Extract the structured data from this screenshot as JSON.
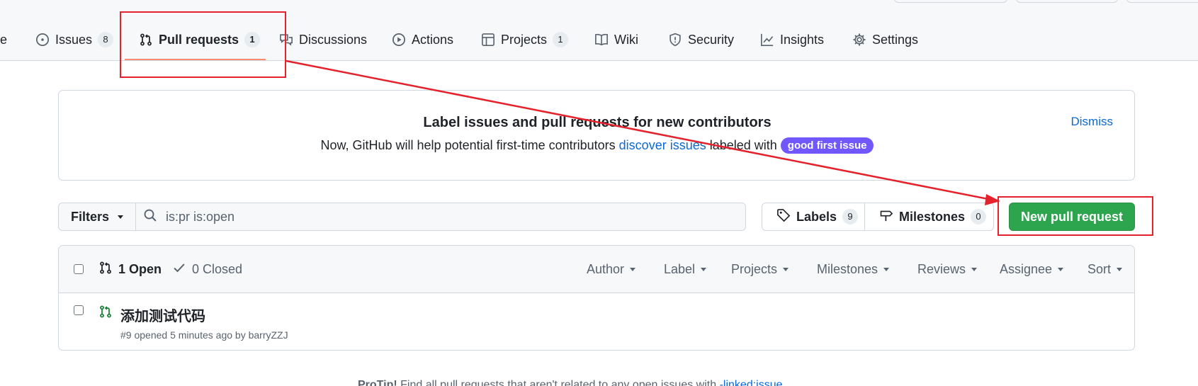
{
  "nav": {
    "tabs": [
      {
        "label": "e",
        "icon": "code-icon"
      },
      {
        "label": "Issues",
        "count": "8",
        "icon": "issue-opened-icon"
      },
      {
        "label": "Pull requests",
        "count": "1",
        "icon": "git-pull-request-icon",
        "selected": true
      },
      {
        "label": "Discussions",
        "icon": "comment-discussion-icon"
      },
      {
        "label": "Actions",
        "icon": "play-icon"
      },
      {
        "label": "Projects",
        "count": "1",
        "icon": "table-icon"
      },
      {
        "label": "Wiki",
        "icon": "book-icon"
      },
      {
        "label": "Security",
        "icon": "shield-icon"
      },
      {
        "label": "Insights",
        "icon": "graph-icon"
      },
      {
        "label": "Settings",
        "icon": "gear-icon"
      }
    ]
  },
  "banner": {
    "title": "Label issues and pull requests for new contributors",
    "desc_before": "Now, GitHub will help potential first-time contributors ",
    "desc_link": "discover issues",
    "desc_after": " labeled with ",
    "label": "good first issue",
    "dismiss": "Dismiss"
  },
  "filterbar": {
    "filters_label": "Filters",
    "search_value": "is:pr is:open",
    "labels_label": "Labels",
    "labels_count": "9",
    "milestones_label": "Milestones",
    "milestones_count": "0",
    "new_pr_label": "New pull request"
  },
  "list": {
    "open_label": "1 Open",
    "closed_label": "0 Closed",
    "filters": [
      "Author",
      "Label",
      "Projects",
      "Milestones",
      "Reviews",
      "Assignee",
      "Sort"
    ],
    "items": [
      {
        "title": "添加测试代码",
        "meta": "#9 opened 5 minutes ago by barryZZJ"
      }
    ]
  },
  "protip": {
    "prefix": "ProTip!",
    "text": " Find all pull requests that aren't related to any open issues with ",
    "link": "-linked:issue"
  },
  "colors": {
    "accent": "#0969da",
    "primary_button": "#2da44e",
    "label_pill": "#7057ff",
    "annotation": "#e5212b",
    "tab_underline": "#fd8c73"
  }
}
